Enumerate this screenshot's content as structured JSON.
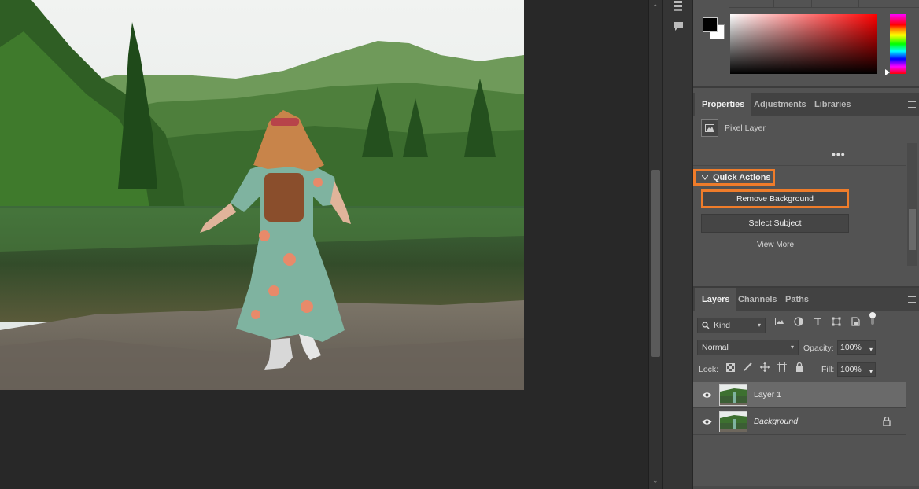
{
  "properties_panel": {
    "tabs": [
      "Properties",
      "Adjustments",
      "Libraries"
    ],
    "layer_type": "Pixel Layer",
    "more": "•••",
    "quick_actions": {
      "title": "Quick Actions",
      "remove_background": "Remove Background",
      "select_subject": "Select Subject",
      "view_more": "View More"
    }
  },
  "layers_panel": {
    "tabs": [
      "Layers",
      "Channels",
      "Paths"
    ],
    "filter_kind": "Kind",
    "blend_mode": "Normal",
    "opacity_label": "Opacity:",
    "opacity_value": "100%",
    "lock_label": "Lock:",
    "fill_label": "Fill:",
    "fill_value": "100%",
    "layers": [
      {
        "name": "Layer 1",
        "selected": true
      },
      {
        "name": "Background",
        "selected": false,
        "locked": true
      }
    ]
  },
  "colors": {
    "accent_highlight": "#ef7c2a",
    "foreground": "#000000",
    "background": "#ffffff",
    "panel_bg": "#535353"
  },
  "icons": {
    "dock": [
      "history-icon",
      "comment-icon"
    ],
    "layer_filters": [
      "image-filter-icon",
      "adjustment-filter-icon",
      "type-filter-icon",
      "shape-filter-icon",
      "smart-object-filter-icon",
      "filter-toggle-icon"
    ],
    "locks": [
      "lock-pixels-icon",
      "lock-paint-icon",
      "lock-position-icon",
      "lock-artboard-icon",
      "lock-all-icon"
    ]
  }
}
